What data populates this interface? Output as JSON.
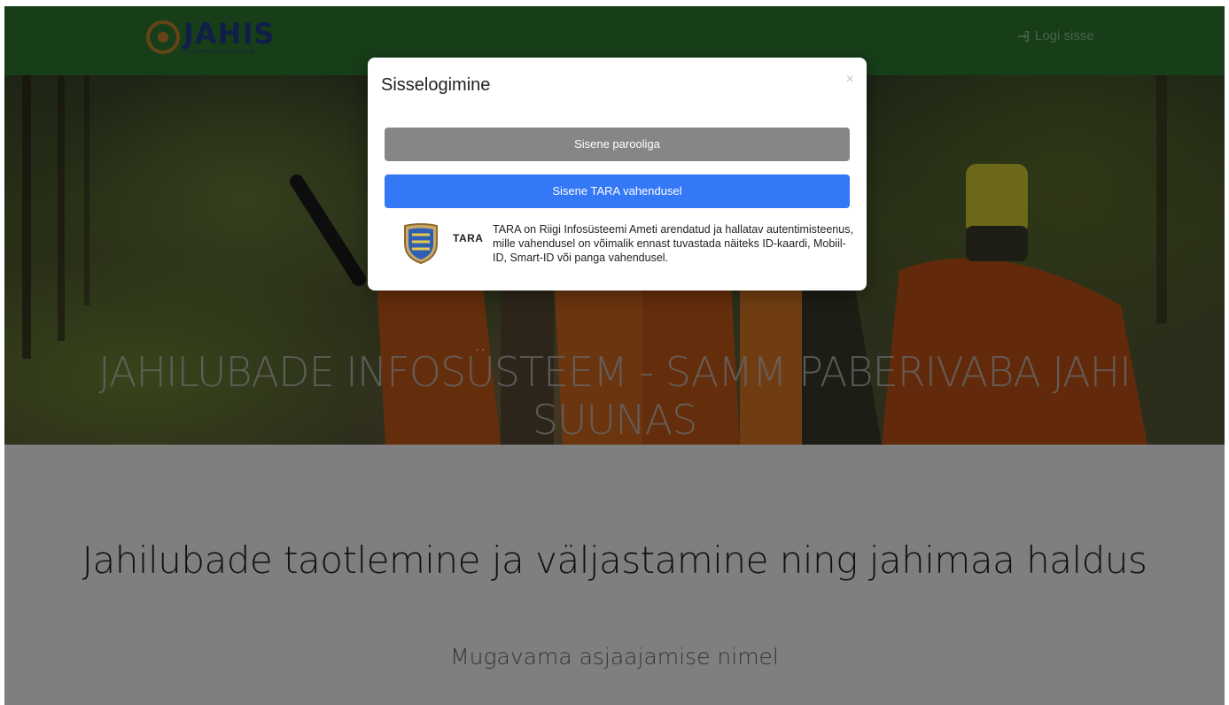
{
  "header": {
    "brand_name": "JAHIS",
    "brand_subtitle": "JAHILUBADE INFOSÜSTEEM",
    "login_label": "Logi sisse",
    "login_icon": "sign-in-icon",
    "background_color": "#2e7d32"
  },
  "hero": {
    "title": "JAHILUBADE INFOSÜSTEEM - SAMM PABERIVABA JAHI SUUNAS"
  },
  "section": {
    "title": "Jahilubade taotlemine ja väljastamine ning jahimaa haldus",
    "subtitle": "Mugavama asjaajamise nimel"
  },
  "modal": {
    "title": "Sisselogimine",
    "close_label": "×",
    "password_button": "Sisene parooliga",
    "tara_button": "Sisene TARA vahendusel",
    "tara_label": "TARA",
    "tara_icon": "estonian-coat-of-arms-icon",
    "tara_description": "TARA on Riigi Infosüsteemi Ameti arendatud ja hallatav autentimisteenus, mille vahendusel on võimalik ennast tuvastada näiteks ID-kaardi, Mobiil-ID, Smart-ID või panga vahendusel.",
    "colors": {
      "password_button": "#868686",
      "tara_button": "#3478f6"
    }
  }
}
